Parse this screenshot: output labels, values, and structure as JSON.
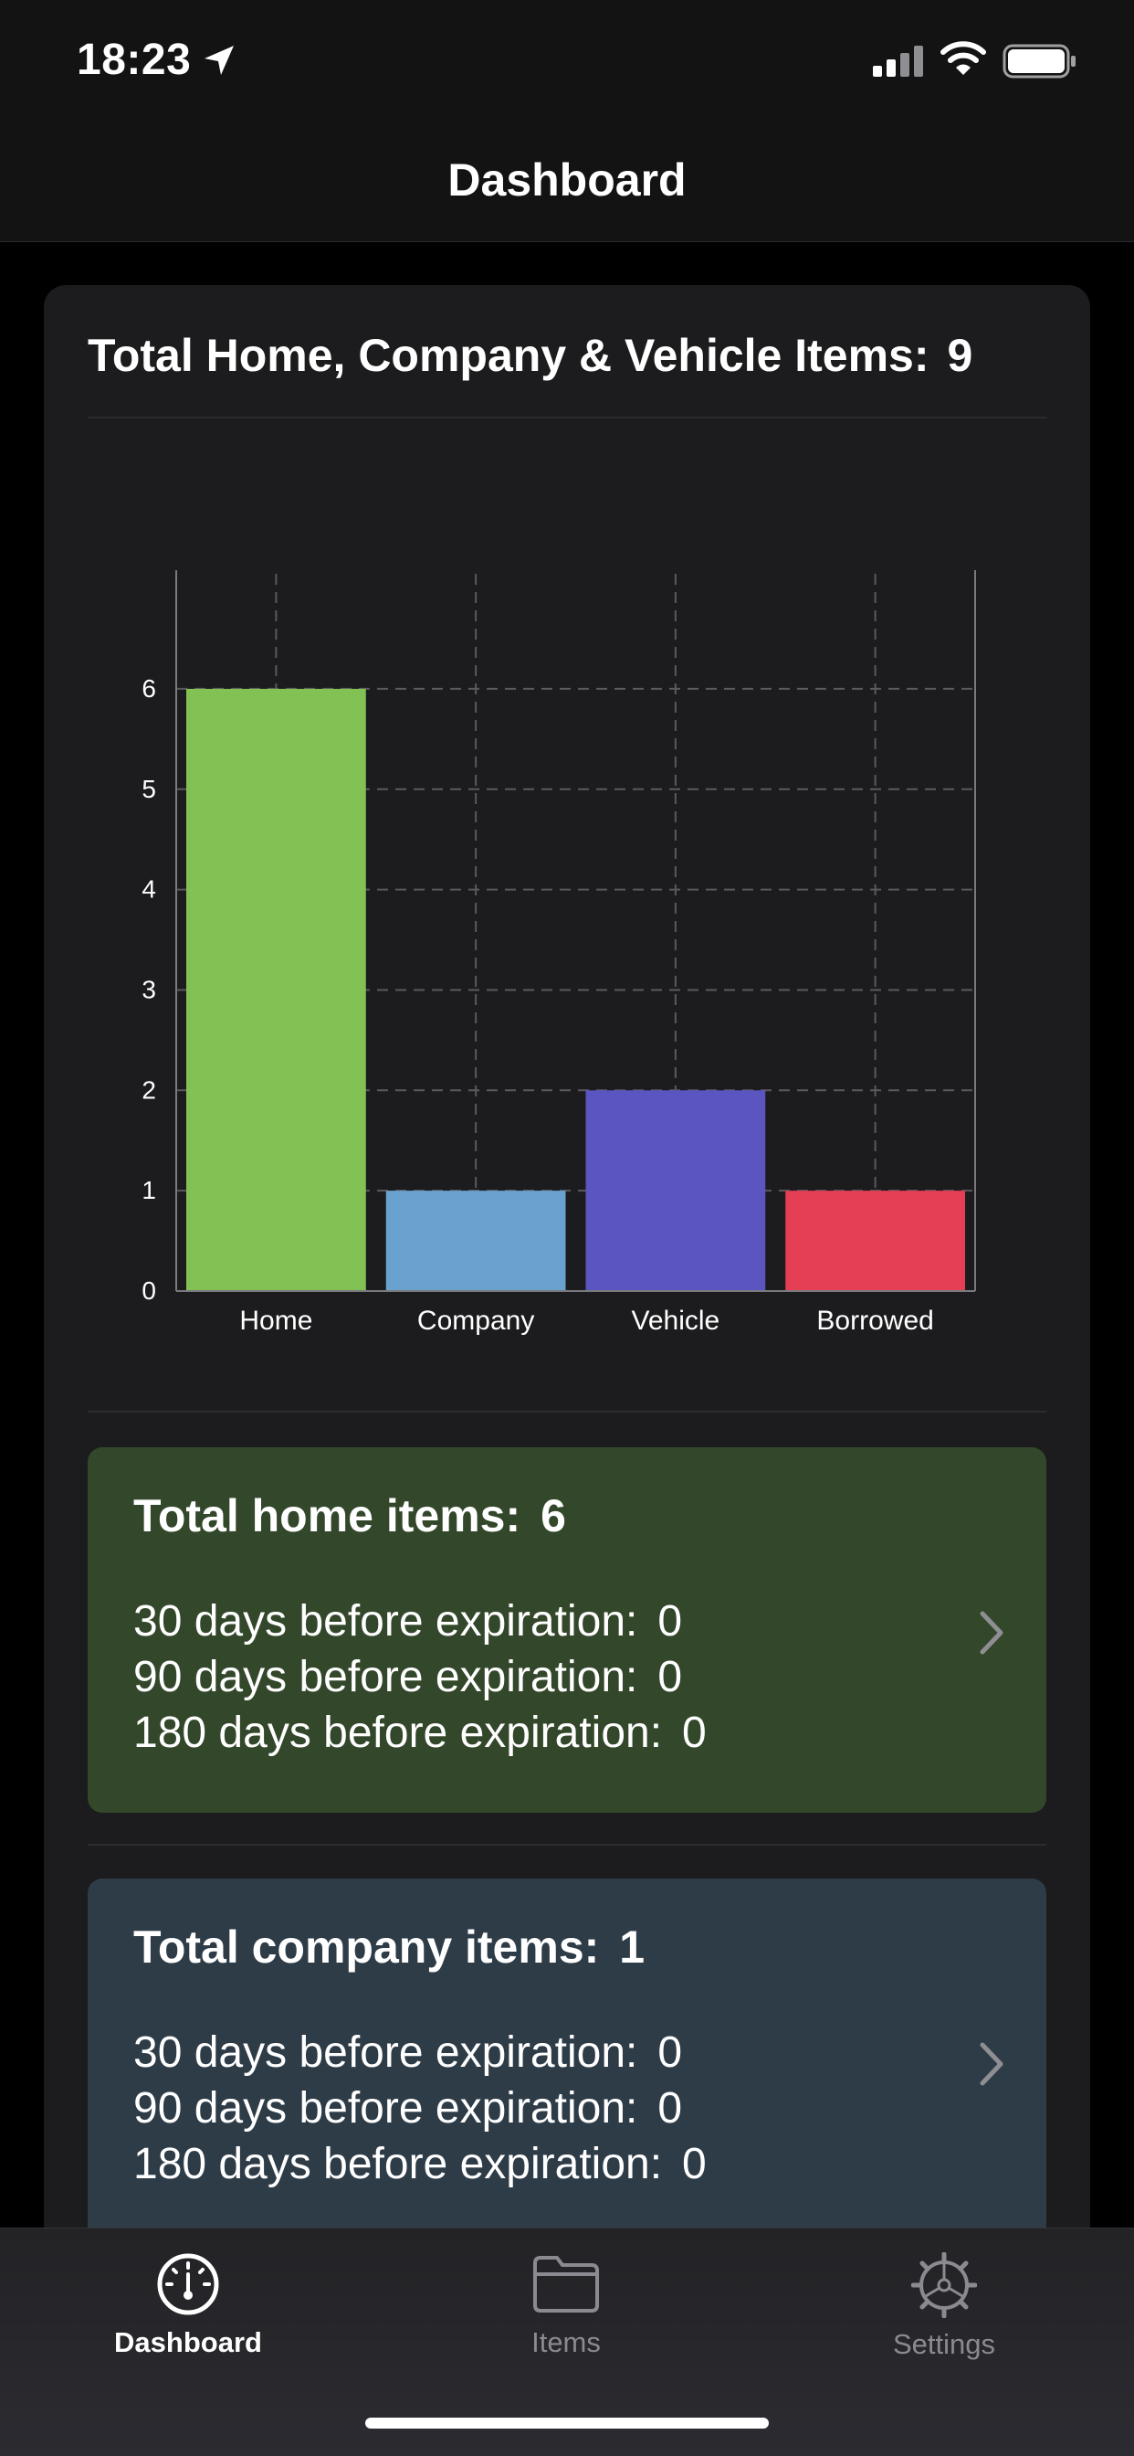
{
  "status_bar": {
    "time": "18:23"
  },
  "nav": {
    "title": "Dashboard"
  },
  "overview": {
    "title": "Total Home, Company & Vehicle Items:",
    "total": "9"
  },
  "chart_data": {
    "type": "bar",
    "categories": [
      "Home",
      "Company",
      "Vehicle",
      "Borrowed"
    ],
    "values": [
      6,
      1,
      2,
      1
    ],
    "colors": [
      "#82c255",
      "#6aa2cf",
      "#5b55c2",
      "#e43f55"
    ],
    "yticks": [
      "0",
      "1",
      "2",
      "3",
      "4",
      "5",
      "6"
    ],
    "ylim": [
      0,
      6.6
    ],
    "grid": true,
    "title": "",
    "xlabel": "",
    "ylabel": ""
  },
  "home_summary": {
    "title": "Total home items:",
    "total": "6",
    "color": "#33472a",
    "lines": [
      {
        "label": "30 days before expiration:",
        "value": "0"
      },
      {
        "label": "90 days before expiration:",
        "value": "0"
      },
      {
        "label": "180 days before expiration:",
        "value": "0"
      }
    ]
  },
  "company_summary": {
    "title": "Total company items:",
    "total": "1",
    "color": "#2e3c48",
    "lines": [
      {
        "label": "30 days before expiration:",
        "value": "0"
      },
      {
        "label": "90 days before expiration:",
        "value": "0"
      },
      {
        "label": "180 days before expiration:",
        "value": "0"
      }
    ]
  },
  "tab_bar": {
    "tabs": [
      {
        "label": "Dashboard",
        "icon": "dashboard-gauge-icon",
        "active": true
      },
      {
        "label": "Items",
        "icon": "folder-icon",
        "active": false
      },
      {
        "label": "Settings",
        "icon": "gear-icon",
        "active": false
      }
    ]
  }
}
